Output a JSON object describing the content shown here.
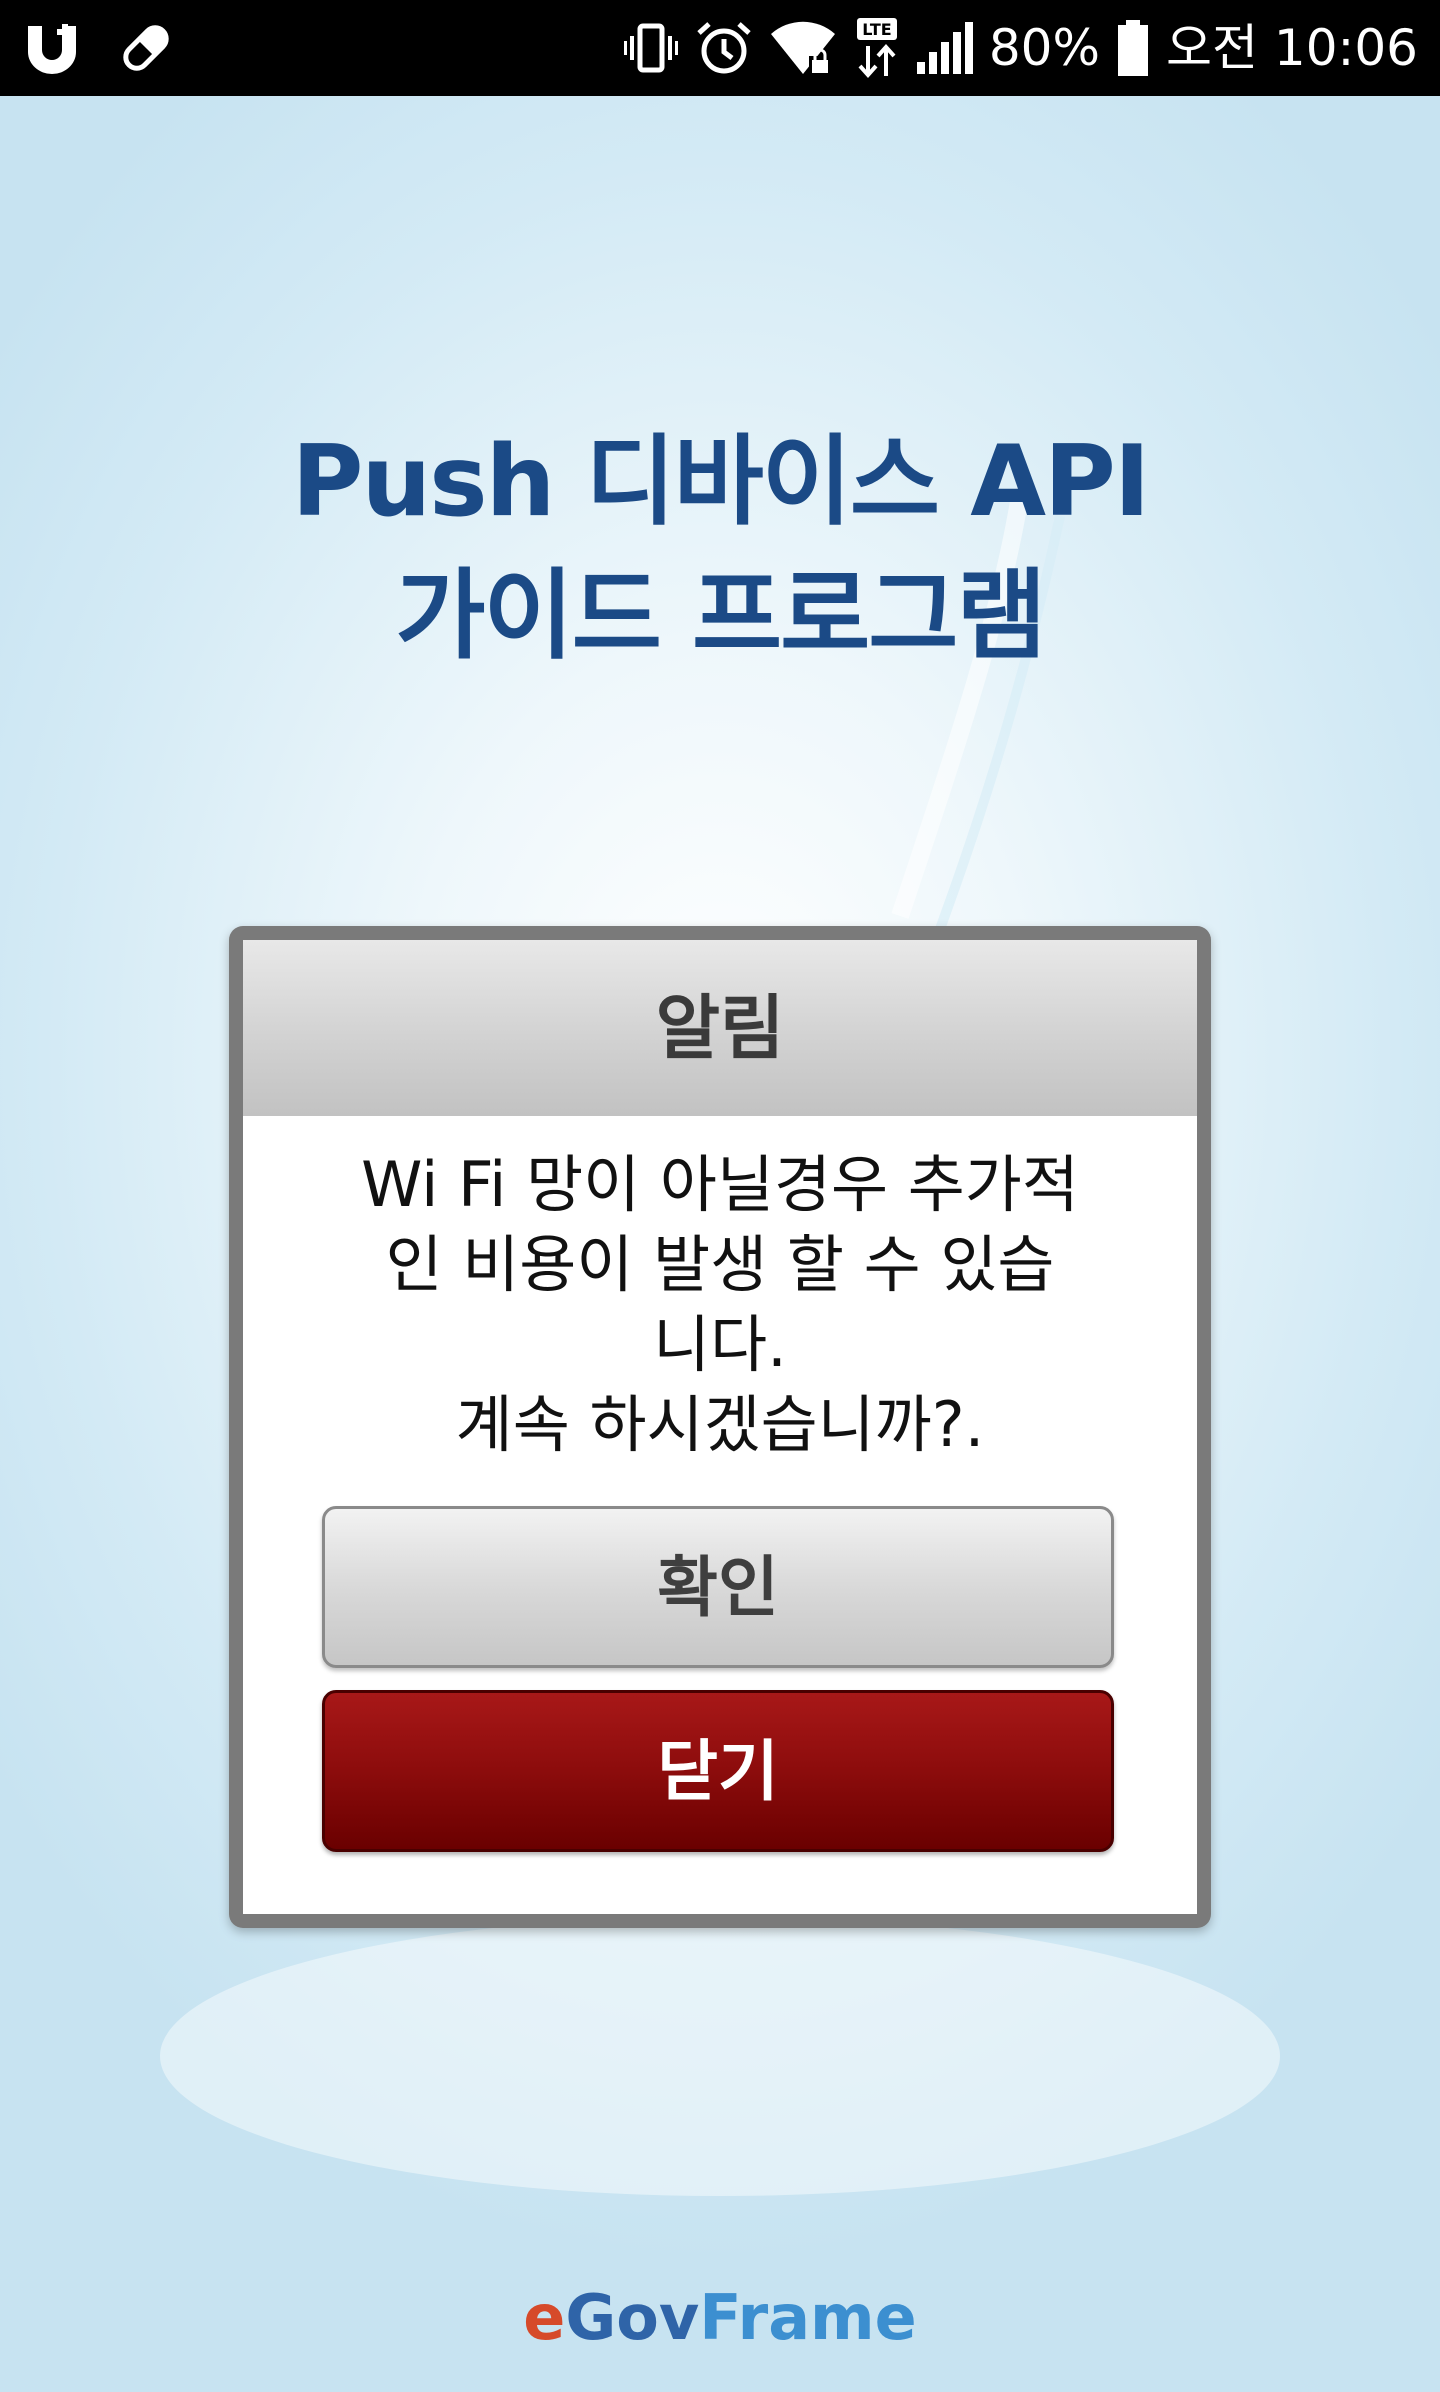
{
  "status_bar": {
    "left_icons": [
      "uplus-carrier-icon",
      "pill-icon"
    ],
    "right_icons": [
      "vibrate-icon",
      "alarm-clock-icon",
      "wifi-locked-icon",
      "lte-data-icon",
      "signal-strength-icon"
    ],
    "battery_percent_text": "80%",
    "battery_level": 0.8,
    "time_text": "오전 10:06"
  },
  "app": {
    "title_line1": "Push 디바이스 API",
    "title_line2": "가이드 프로그램"
  },
  "dialog": {
    "title": "알림",
    "message_lines": [
      "Wi Fi 망이 아닐경우 추가적",
      "인 비용이 발생 할 수 있습",
      "니다.",
      "계속 하시겠습니까?."
    ],
    "confirm_label": "확인",
    "close_label": "닫기"
  },
  "footer": {
    "logo_part_e": "e",
    "logo_part_gov": "Gov",
    "logo_part_frame": "Frame"
  },
  "colors": {
    "title_blue": "#1b4a86",
    "close_button_red": "#8c0c0c",
    "confirm_button_gray": "#d9d9d9",
    "dialog_border": "#7a7a7a"
  }
}
